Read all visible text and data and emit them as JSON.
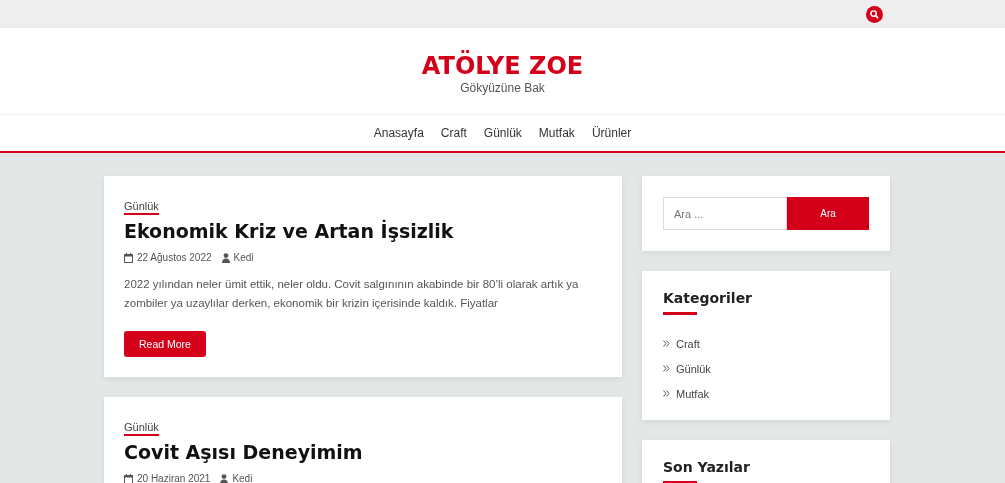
{
  "site": {
    "title": "ATÖLYE ZOE",
    "tagline": "Gökyüzüne Bak"
  },
  "nav": [
    {
      "label": "Anasayfa"
    },
    {
      "label": "Craft"
    },
    {
      "label": "Günlük"
    },
    {
      "label": "Mutfak"
    },
    {
      "label": "Ürünler"
    }
  ],
  "posts": [
    {
      "category": "Günlük",
      "title": "Ekonomik Kriz ve Artan İşsizlik",
      "date": "22 Ağustos 2022",
      "author": "Kedi",
      "excerpt": "2022 yılından neler ümit ettik, neler oldu. Covit salgınının akabinde bir 80’li olarak artık ya zombiler ya uzaylılar derken, ekonomik bir krizin içerisinde kaldık. Fiyatlar",
      "button": "Read More"
    },
    {
      "category": "Günlük",
      "title": "Covit Aşısı Deneyimim",
      "date": "20 Haziran 2021",
      "author": "Kedi"
    }
  ],
  "sidebar": {
    "search": {
      "placeholder": "Ara ...",
      "button": "Ara"
    },
    "widgets": [
      {
        "title": "Kategoriler",
        "items": [
          "Craft",
          "Günlük",
          "Mutfak"
        ]
      },
      {
        "title": "Son Yazılar"
      }
    ]
  }
}
